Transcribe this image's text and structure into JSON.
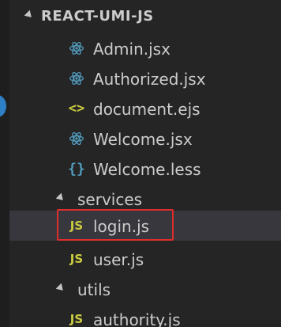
{
  "explorer": {
    "folder_name": "REACT-UMI-JS",
    "files_top": [
      {
        "name": "Admin.jsx",
        "icon": "react-icon"
      },
      {
        "name": "Authorized.jsx",
        "icon": "react-icon"
      },
      {
        "name": "document.ejs",
        "icon": "code-brackets-icon"
      },
      {
        "name": "Welcome.jsx",
        "icon": "react-icon"
      },
      {
        "name": "Welcome.less",
        "icon": "curly-braces-icon"
      }
    ],
    "services": {
      "name": "services",
      "files": [
        {
          "name": "login.js",
          "icon": "js-icon",
          "icon_text": "JS"
        },
        {
          "name": "user.js",
          "icon": "js-icon",
          "icon_text": "JS"
        }
      ]
    },
    "utils": {
      "name": "utils",
      "files": [
        {
          "name": "authority.js",
          "icon": "js-icon",
          "icon_text": "JS"
        }
      ]
    },
    "glyphs": {
      "code": "<>",
      "braces": "{}"
    }
  },
  "colors": {
    "background": "#252526",
    "text": "#cccccc",
    "react": "#519aba",
    "js": "#cbcb41",
    "highlight": "#e02d2d",
    "selected_row": "#37373d"
  }
}
